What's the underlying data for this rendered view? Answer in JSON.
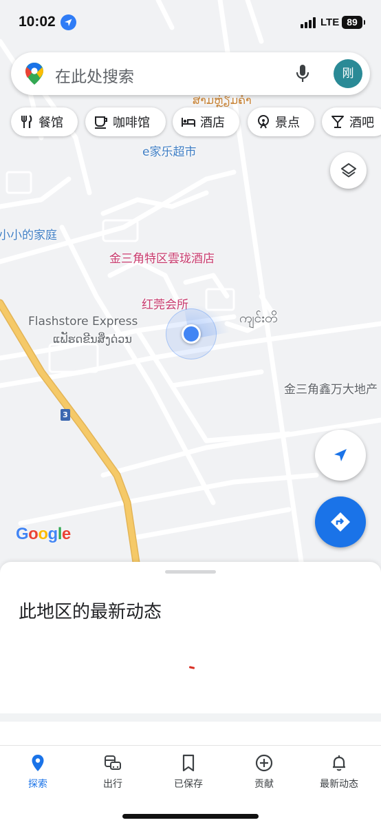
{
  "status_bar": {
    "time": "10:02",
    "network": "LTE",
    "battery": "89",
    "icons": [
      "location-arrow-icon",
      "signal-icon",
      "battery-icon"
    ]
  },
  "search": {
    "placeholder": "在此处搜索",
    "avatar_initial": "刚",
    "icons": [
      "maps-pin-icon",
      "microphone-icon"
    ]
  },
  "chips": [
    {
      "label": "餐馆",
      "icon": "restaurant-icon"
    },
    {
      "label": "咖啡馆",
      "icon": "coffee-icon"
    },
    {
      "label": "酒店",
      "icon": "hotel-bed-icon"
    },
    {
      "label": "景点",
      "icon": "attraction-icon"
    },
    {
      "label": "酒吧",
      "icon": "cocktail-icon"
    }
  ],
  "map": {
    "labels": {
      "lao_top": "ສາມຫຼ່ຽມຄໍາ",
      "supermarket": "e家乐超市",
      "family": "小小的家庭",
      "hotel": "金三角特区雲珑酒店",
      "club": "红莞会所",
      "flashstore": "Flashstore Express",
      "flashstore_lao": "ແຟັຮດຂີນສິ່ງດ່ວນ",
      "burmese": "ကျင်းတိ",
      "realestate": "金三角鑫万大地产"
    },
    "route_number": "3",
    "google_logo": [
      "G",
      "o",
      "o",
      "g",
      "l",
      "e"
    ],
    "colors": {
      "road_primary": "#f5c968",
      "road_secondary": "#ffffff",
      "map_background": "#f1f2f4",
      "location_blue": "#4285f4"
    }
  },
  "buttons": {
    "layers": "layers-icon",
    "locate": "navigation-arrow-icon",
    "directions": "directions-icon"
  },
  "sheet": {
    "title": "此地区的最新动态"
  },
  "bottom_nav": [
    {
      "label": "探索",
      "icon": "explore-pin-icon",
      "active": true
    },
    {
      "label": "出行",
      "icon": "commute-icon",
      "active": false
    },
    {
      "label": "已保存",
      "icon": "bookmark-icon",
      "active": false
    },
    {
      "label": "贡献",
      "icon": "add-circle-icon",
      "active": false
    },
    {
      "label": "最新动态",
      "icon": "bell-icon",
      "active": false
    }
  ],
  "theme": {
    "accent": "#1a73e8",
    "label_blue": "#3f7ec4",
    "label_pink": "#c83a6d"
  }
}
